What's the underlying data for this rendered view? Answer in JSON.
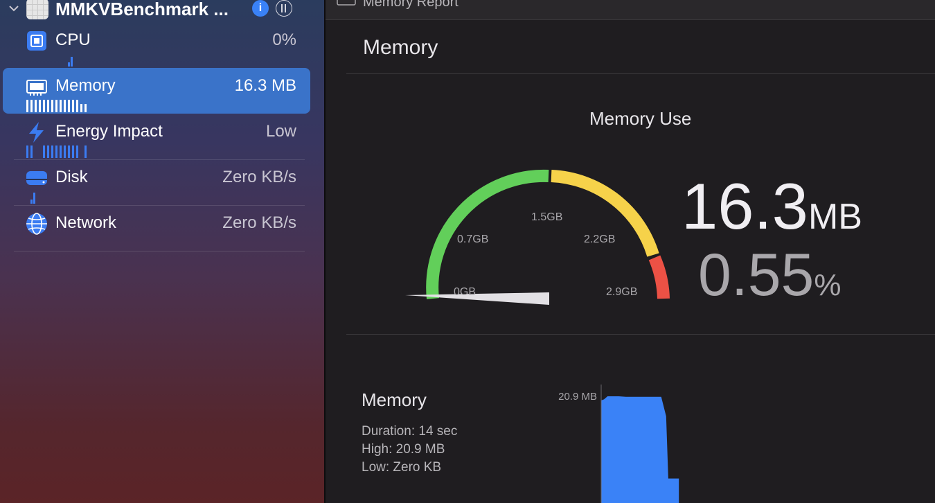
{
  "sidebar": {
    "app_name": "MMKVBenchmark ...",
    "info_icon": "info-icon",
    "pause_icon": "pause-circle-icon",
    "items": [
      {
        "label": "CPU",
        "value": "0%",
        "icon": "cpu-icon"
      },
      {
        "label": "Memory",
        "value": "16.3 MB",
        "icon": "memory-icon",
        "selected": true
      },
      {
        "label": "Energy Impact",
        "value": "Low",
        "icon": "bolt-icon"
      },
      {
        "label": "Disk",
        "value": "Zero KB/s",
        "icon": "disk-icon"
      },
      {
        "label": "Network",
        "value": "Zero KB/s",
        "icon": "globe-icon"
      }
    ],
    "colors": {
      "accent": "#3b7cf2",
      "selected": "#3a73c9"
    }
  },
  "report": {
    "title": "Memory Report",
    "section_title": "Memory",
    "memory_use_title": "Memory Use",
    "gauge_labels": [
      "0GB",
      "0.7GB",
      "1.5GB",
      "2.2GB",
      "2.9GB"
    ],
    "gauge_colors": {
      "green": "#62cf5a",
      "yellow": "#f6d24a",
      "red": "#ec5145"
    },
    "current_value": "16.3",
    "current_unit": "MB",
    "percent_value": "0.55",
    "percent_unit": "%"
  },
  "chart": {
    "title": "Memory",
    "duration": "Duration: 14 sec",
    "high": "High: 20.9 MB",
    "low": "Low: Zero KB",
    "y_label": "20.9 MB"
  },
  "chart_data": {
    "type": "area",
    "title": "Memory",
    "ylabel": "",
    "xlabel": "",
    "y_unit": "MB",
    "ylim": [
      0,
      20.9
    ],
    "x": [
      0,
      0.4,
      0.9,
      1.5,
      2.5,
      3.5,
      4.5,
      5.5,
      6.5,
      7.5,
      8.5,
      9.2,
      9.5,
      10.0,
      11.0
    ],
    "values": [
      20.1,
      20.3,
      20.9,
      20.9,
      20.9,
      20.8,
      20.8,
      20.8,
      20.8,
      20.8,
      20.8,
      17.0,
      4.8,
      4.8,
      4.8
    ],
    "color": "#3a82f7",
    "grid": false
  }
}
